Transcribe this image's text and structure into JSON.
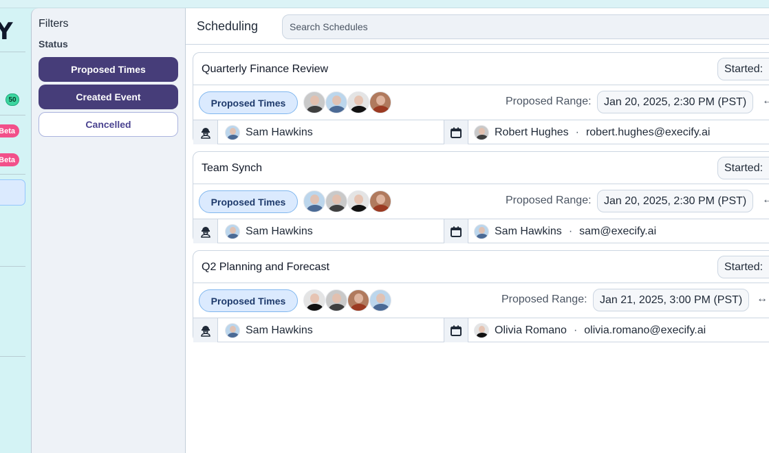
{
  "nav": {
    "logo_fragment": "Y",
    "count_badge": "50",
    "beta_badges": [
      "Beta",
      "Beta"
    ]
  },
  "filters": {
    "title": "Filters",
    "status_label": "Status",
    "buttons": [
      {
        "label": "Proposed Times",
        "active": true
      },
      {
        "label": "Created Event",
        "active": true
      },
      {
        "label": "Cancelled",
        "active": false
      }
    ]
  },
  "main": {
    "title": "Scheduling",
    "search_placeholder": "Search Schedules"
  },
  "schedules": [
    {
      "name": "Quarterly Finance Review",
      "started_label": "Started:",
      "status": "Proposed Times",
      "participants": [
        "male-1",
        "female-blonde",
        "female-dark",
        "female-red"
      ],
      "range_label": "Proposed Range:",
      "range_start": "Jan 20, 2025, 2:30 PM (PST)",
      "range_arrow": "←",
      "organizer": "Sam Hawkins",
      "contact_name": "Robert Hughes",
      "contact_email": "robert.hughes@execify.ai",
      "separator": "·"
    },
    {
      "name": "Team Synch",
      "started_label": "Started:",
      "status": "Proposed Times",
      "participants": [
        "female-blonde",
        "male-1",
        "female-dark",
        "female-red"
      ],
      "range_label": "Proposed Range:",
      "range_start": "Jan 20, 2025, 2:30 PM (PST)",
      "range_arrow": "←",
      "organizer": "Sam Hawkins",
      "contact_name": "Sam Hawkins",
      "contact_email": "sam@execify.ai",
      "separator": "·"
    },
    {
      "name": "Q2 Planning and Forecast",
      "started_label": "Started:",
      "status": "Proposed Times",
      "participants": [
        "female-dark",
        "male-1",
        "female-red",
        "female-blonde"
      ],
      "range_label": "Proposed Range:",
      "range_start": "Jan 21, 2025, 3:00 PM (PST)",
      "range_arrow": "↔",
      "organizer": "Sam Hawkins",
      "contact_name": "Olivia Romano",
      "contact_email": "olivia.romano@execify.ai",
      "separator": "·"
    }
  ],
  "icons": {
    "organizer": "worker-helmet-icon",
    "event": "calendar-icon"
  }
}
